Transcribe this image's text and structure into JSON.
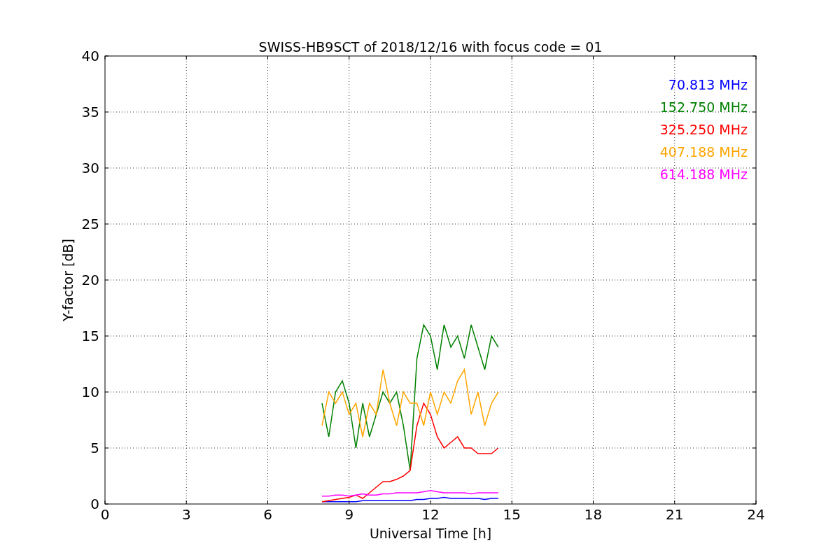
{
  "chart_data": {
    "type": "line",
    "title": "SWISS-HB9SCT of 2018/12/16 with focus code = 01",
    "xlabel": "Universal Time [h]",
    "ylabel": "Y-factor [dB]",
    "x": [
      8,
      8.25,
      8.5,
      8.75,
      9,
      9.25,
      9.5,
      9.75,
      10,
      10.25,
      10.5,
      10.75,
      11,
      11.25,
      11.5,
      11.75,
      12,
      12.25,
      12.5,
      12.75,
      13,
      13.25,
      13.5,
      13.75,
      14,
      14.25,
      14.5
    ],
    "series": [
      {
        "name": "70.813 MHz",
        "color": "#0000ff",
        "values": [
          0.2,
          0.2,
          0.2,
          0.2,
          0.2,
          0.2,
          0.3,
          0.3,
          0.3,
          0.3,
          0.3,
          0.3,
          0.3,
          0.3,
          0.4,
          0.4,
          0.5,
          0.5,
          0.6,
          0.5,
          0.5,
          0.5,
          0.5,
          0.5,
          0.4,
          0.5,
          0.5
        ]
      },
      {
        "name": "152.750 MHz",
        "color": "#008000",
        "values": [
          9,
          6,
          10,
          11,
          9,
          5,
          9,
          6,
          8,
          10,
          9,
          10,
          7,
          3,
          13,
          16,
          15,
          12,
          16,
          14,
          15,
          13,
          16,
          14,
          12,
          15,
          14
        ]
      },
      {
        "name": "325.250 MHz",
        "color": "#ff0000",
        "values": [
          0.2,
          0.3,
          0.4,
          0.5,
          0.6,
          0.8,
          0.5,
          1,
          1.5,
          2,
          2,
          2.2,
          2.5,
          3,
          7,
          9,
          8,
          6,
          5,
          5.5,
          6,
          5,
          5,
          4.5,
          4.5,
          4.5,
          5
        ]
      },
      {
        "name": "407.188 MHz",
        "color": "#ffa500",
        "values": [
          7,
          10,
          9,
          10,
          8,
          9,
          6,
          9,
          8,
          12,
          9,
          7,
          10,
          9,
          9,
          7,
          10,
          8,
          10,
          9,
          11,
          12,
          8,
          10,
          7,
          9,
          10
        ]
      },
      {
        "name": "614.188 MHz",
        "color": "#ff00ff",
        "values": [
          0.7,
          0.7,
          0.8,
          0.8,
          0.7,
          0.8,
          0.9,
          0.8,
          0.8,
          0.9,
          0.9,
          1,
          1,
          1,
          1,
          1.1,
          1.2,
          1.1,
          1,
          1,
          1,
          1,
          0.9,
          1,
          1,
          1,
          1
        ]
      }
    ],
    "xlim": [
      0,
      24
    ],
    "ylim": [
      0,
      40
    ],
    "xticks": [
      0,
      3,
      6,
      9,
      12,
      15,
      18,
      21,
      24
    ],
    "yticks": [
      0,
      5,
      10,
      15,
      20,
      25,
      30,
      35,
      40
    ],
    "grid": true
  }
}
